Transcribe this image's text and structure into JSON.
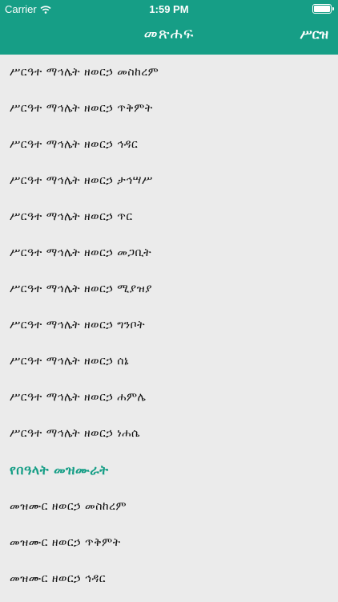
{
  "status_bar": {
    "carrier": "Carrier",
    "time": "1:59 PM"
  },
  "nav": {
    "title": "መጽሐፍ",
    "action_label": "ሥርዝ"
  },
  "section1_items": [
    "ሥርዓተ ማኅሌት ዘወርኃ መስከረም",
    "ሥርዓተ ማኅሌት ዘወርኃ ጥቅምት",
    "ሥርዓተ ማኅሌት ዘወርኃ ኅዳር",
    "ሥርዓተ ማኅሌት ዘወርኃ ታኅሣሥ",
    "ሥርዓተ ማኅሌት ዘወርኃ ጥር",
    "ሥርዓተ ማኅሌት ዘወርኃ መጋቢት",
    "ሥርዓተ ማኅሌት ዘወርኃ ሚያዝያ",
    "ሥርዓተ ማኅሌት ዘወርኃ ግንቦት",
    "ሥርዓተ ማኅሌት ዘወርኃ ሰኔ",
    "ሥርዓተ ማኅሌት ዘወርኃ ሐምሌ",
    "ሥርዓተ ማኅሌት ዘወርኃ ነሐሴ"
  ],
  "section2": {
    "title": "የበዓላት መዝሙራት",
    "items": [
      "መዝሙር ዘወርኃ መስከረም",
      "መዝሙር ዘወርኃ ጥቅምት",
      "መዝሙር ዘወርኃ ኅዳር"
    ]
  },
  "colors": {
    "accent": "#169e86",
    "background": "#ebebeb"
  }
}
